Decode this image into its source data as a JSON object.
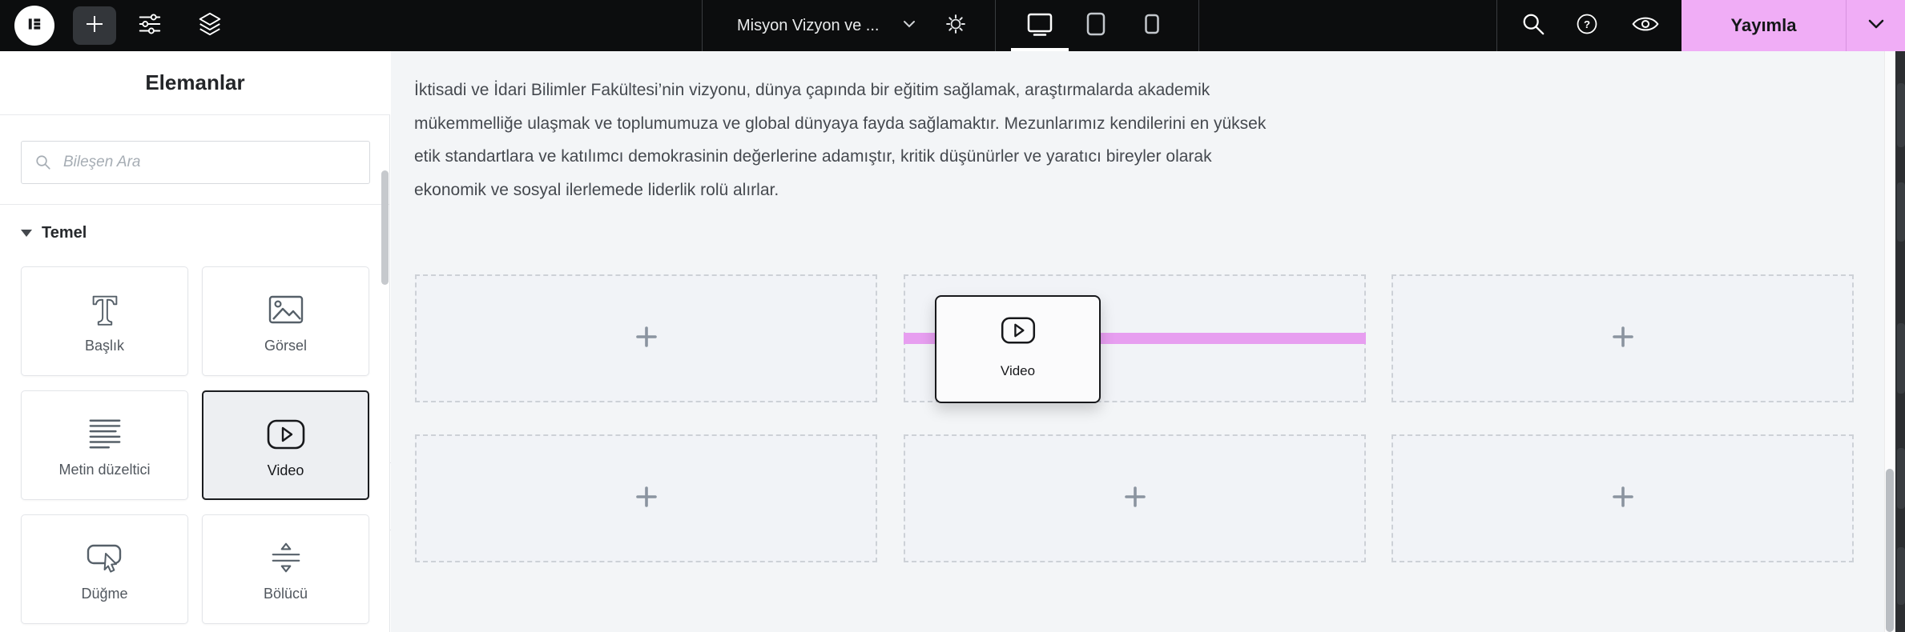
{
  "topbar": {
    "background": "#0c0d0e",
    "document_title": "Misyon Vizyon ve ...",
    "publish_button": "Yayımla",
    "accent_color": "#f0adf6",
    "devices": {
      "active": "desktop",
      "options": [
        "desktop",
        "tablet",
        "mobile"
      ]
    },
    "icons": [
      "elementor-logo",
      "add-element-icon",
      "site-settings-icon",
      "structure-icon",
      "chevron-down-icon",
      "page-settings-gear-icon",
      "desktop-icon",
      "tablet-icon",
      "mobile-icon",
      "search-icon",
      "help-icon",
      "preview-icon",
      "chevron-down-icon"
    ]
  },
  "panel": {
    "title": "Elemanlar",
    "search": {
      "placeholder": "Bileşen Ara",
      "value": "",
      "icon": "search-icon"
    },
    "section_title": "Temel",
    "widgets": [
      {
        "label": "Başlık",
        "icon": "heading-icon",
        "selected": false
      },
      {
        "label": "Görsel",
        "icon": "image-icon",
        "selected": false
      },
      {
        "label": "Metin düzeltici",
        "icon": "text-editor-icon",
        "selected": false
      },
      {
        "label": "Video",
        "icon": "video-icon",
        "selected": true
      },
      {
        "label": "Düğme",
        "icon": "button-icon",
        "selected": false
      },
      {
        "label": "Bölücü",
        "icon": "divider-icon",
        "selected": false
      }
    ]
  },
  "canvas": {
    "background": "#f3f5f7",
    "paragraph_lines": [
      "İktisadi ve İdari Bilimler Fakültesi’nin vizyonu, dünya çapında bir eğitim sağlamak, araştırmalarda akademik",
      "mükemmelliğe ulaşmak ve toplumumuza ve global dünyaya fayda sağlamaktır. Mezunlarımız kendilerini en yüksek",
      "etik standartlara ve katılımcı demokrasinin değerlerine adamıştır, kritik düşünürler ve yaratıcı bireyler olarak",
      "ekonomik ve sosyal ilerlemede liderlik rolü alırlar."
    ],
    "drop_zones": {
      "rows": 2,
      "columns": 3,
      "plus_icon": "plus-icon"
    },
    "insertion_line_color": "#e79ef0",
    "dragged_widget": {
      "label": "Video",
      "icon": "video-icon"
    }
  }
}
